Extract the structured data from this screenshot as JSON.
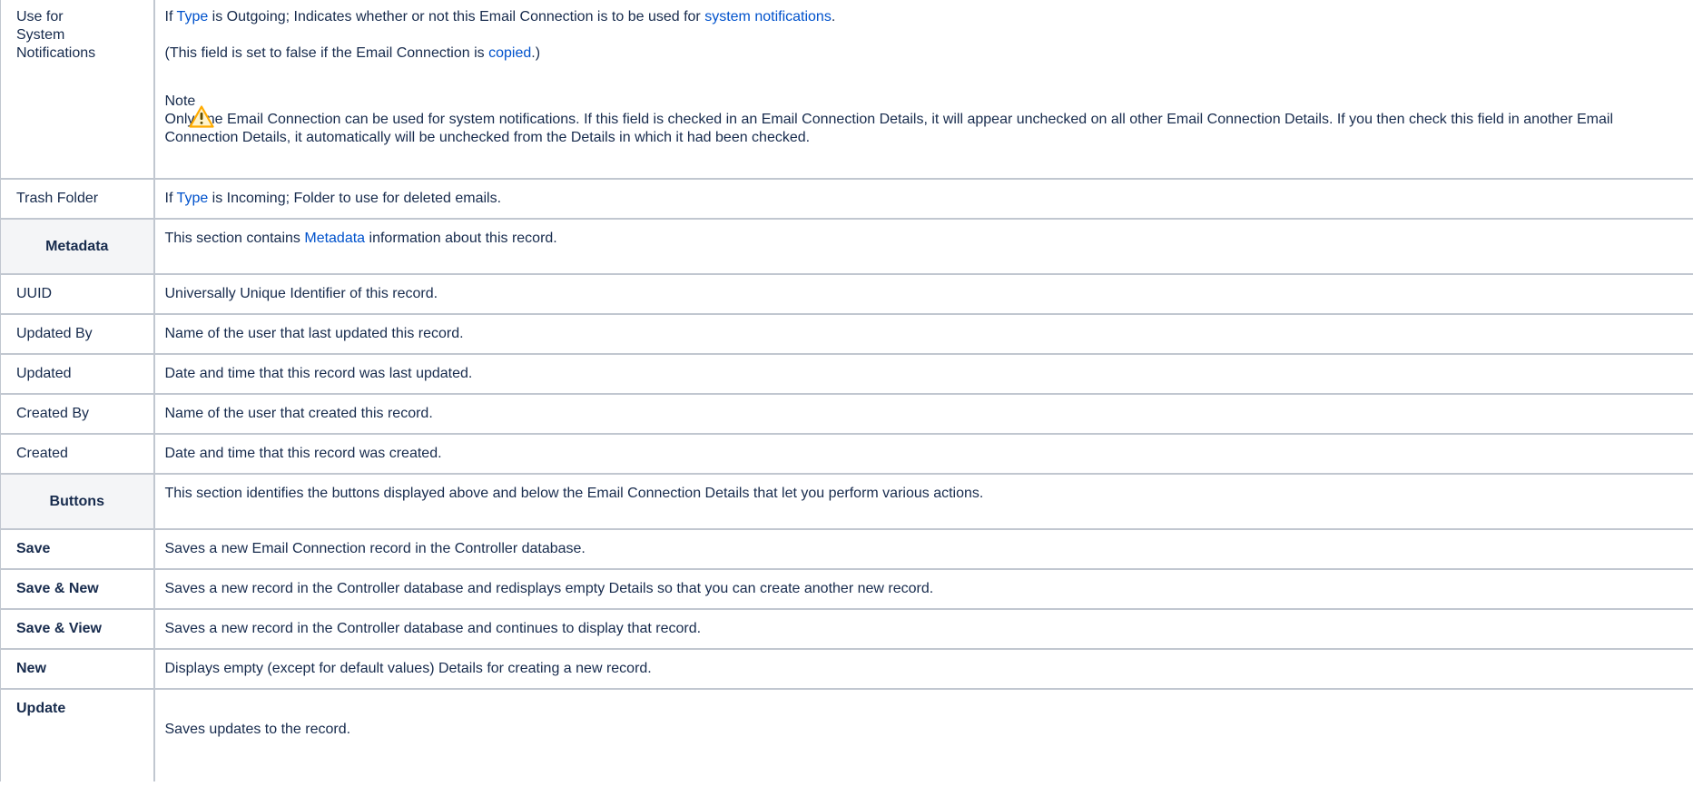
{
  "rows": {
    "use_for_notifications": {
      "label_line1": "Use for",
      "label_line2": "System",
      "label_line3": "Notifications",
      "p1_prefix": "If ",
      "p1_link1": "Type",
      "p1_mid": " is Outgoing; Indicates whether or not this Email Connection is to be used for ",
      "p1_link2": "system notifications",
      "p1_suffix": ".",
      "p2_prefix": "(This field is set to false if the Email Connection is ",
      "p2_link": "copied",
      "p2_suffix": ".)",
      "note_title": "Note",
      "note_icon": "warning-icon",
      "note_body": "Only one Email Connection can be used for system notifications. If this field is checked in an Email Connection Details, it will appear unchecked on all other Email Connection Details. If you then check this field in another Email Connection Details, it automatically will be unchecked from the Details in which it had been checked."
    },
    "trash_folder": {
      "label": "Trash Folder",
      "prefix": "If ",
      "link": "Type",
      "suffix": " is Incoming; Folder to use for deleted emails."
    },
    "metadata_header": {
      "label": "Metadata",
      "prefix": "This section contains ",
      "link": "Metadata",
      "suffix": " information about this record."
    },
    "uuid": {
      "label": "UUID",
      "desc": "Universally Unique Identifier of this record."
    },
    "updated_by": {
      "label": "Updated By",
      "desc": "Name of the user that last updated this record."
    },
    "updated": {
      "label": "Updated",
      "desc": "Date and time that this record was last updated."
    },
    "created_by": {
      "label": "Created By",
      "desc": "Name of the user that created this record."
    },
    "created": {
      "label": "Created",
      "desc": "Date and time that this record was created."
    },
    "buttons_header": {
      "label": "Buttons",
      "desc": "This section identifies the buttons displayed above and below the Email Connection Details that let you perform various actions."
    },
    "save": {
      "label": "Save",
      "desc": "Saves a new Email Connection record in the Controller database."
    },
    "save_new": {
      "label": "Save & New",
      "desc": "Saves a new record in the Controller database and redisplays empty Details so that you can create another new record."
    },
    "save_view": {
      "label": "Save & View",
      "desc": "Saves a new record in the Controller database and continues to display that record."
    },
    "new": {
      "label": "New",
      "desc": "Displays empty (except for default values) Details for creating a new record."
    },
    "update": {
      "label": "Update",
      "desc": "Saves updates to the record."
    }
  },
  "colors": {
    "link": "#0052cc",
    "text": "#172b4d",
    "border": "#c1c7d0",
    "header_bg": "#f4f5f7",
    "warning": "#ffab00"
  }
}
